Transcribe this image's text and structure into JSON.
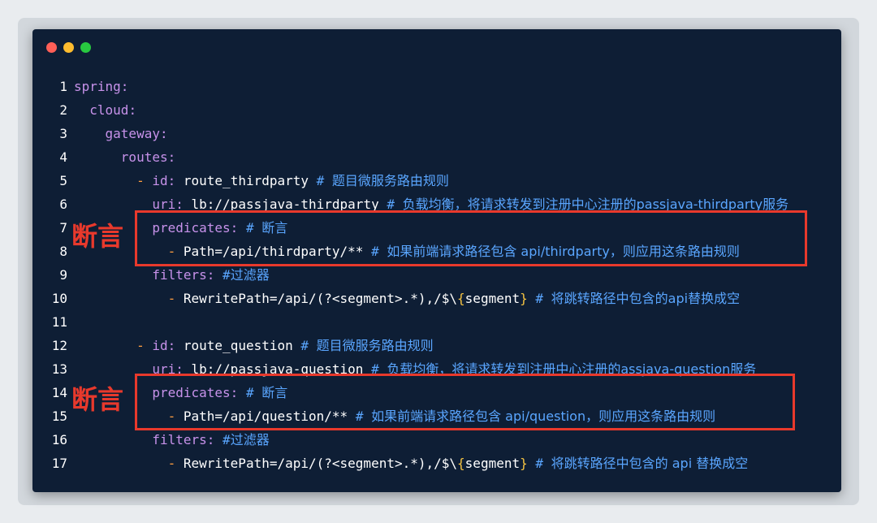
{
  "window": {
    "controls": [
      "close",
      "minimize",
      "maximize"
    ],
    "colors": {
      "close": "#ff5f57",
      "minimize": "#febc2e",
      "maximize": "#28c840",
      "background": "#0e1e35"
    }
  },
  "annotations": {
    "label_1": "断言",
    "label_2": "断言",
    "color": "#e8392c"
  },
  "code": {
    "lines": [
      {
        "n": "1",
        "key": "spring",
        "colon": ":"
      },
      {
        "n": "2",
        "key": "cloud",
        "colon": ":"
      },
      {
        "n": "3",
        "key": "gateway",
        "colon": ":"
      },
      {
        "n": "4",
        "key": "routes",
        "colon": ":"
      },
      {
        "n": "5",
        "dash": "-",
        "key": "id",
        "colon": ":",
        "value": "route_thirdparty",
        "comment": "# 题目微服务路由规则"
      },
      {
        "n": "6",
        "key": "uri",
        "colon": ":",
        "value": "lb://passjava-thirdparty",
        "comment": "# 负载均衡，将请求转发到注册中心注册的passjava-thirdparty服务"
      },
      {
        "n": "7",
        "key": "predicates",
        "colon": ":",
        "comment": "# 断言"
      },
      {
        "n": "8",
        "dash": "-",
        "value": "Path=/api/thirdparty/**",
        "comment": "# 如果前端请求路径包含 api/thirdparty，则应用这条路由规则"
      },
      {
        "n": "9",
        "key": "filters",
        "colon": ":",
        "comment": "#过滤器"
      },
      {
        "n": "10",
        "dash": "-",
        "value": "RewritePath=/api/(?<segment>.*),/$\\",
        "brace_open": "{",
        "value2": "segment",
        "brace_close": "}",
        "comment": "# 将跳转路径中包含的api替换成空"
      },
      {
        "n": "11"
      },
      {
        "n": "12",
        "dash": "-",
        "key": "id",
        "colon": ":",
        "value": "route_question",
        "comment": "# 题目微服务路由规则"
      },
      {
        "n": "13",
        "key": "uri",
        "colon": ":",
        "value": "lb://passjava-question",
        "comment": "# 负载均衡，将请求转发到注册中心注册的assjava-question服务"
      },
      {
        "n": "14",
        "key": "predicates",
        "colon": ":",
        "comment": "# 断言"
      },
      {
        "n": "15",
        "dash": "-",
        "value": "Path=/api/question/**",
        "comment": "# 如果前端请求路径包含 api/question，则应用这条路由规则"
      },
      {
        "n": "16",
        "key": "filters",
        "colon": ":",
        "comment": "#过滤器"
      },
      {
        "n": "17",
        "dash": "-",
        "value": "RewritePath=/api/(?<segment>.*),/$\\",
        "brace_open": "{",
        "value2": "segment",
        "brace_close": "}",
        "comment": "# 将跳转路径中包含的 api 替换成空"
      }
    ]
  }
}
